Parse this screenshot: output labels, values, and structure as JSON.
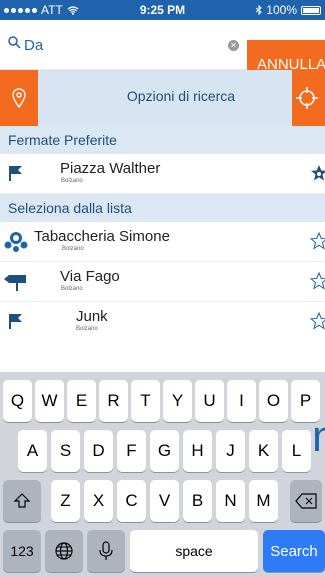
{
  "status_bar": {
    "carrier": "ATT",
    "time": "9:25 PM",
    "battery": "100%"
  },
  "search": {
    "query": "Da",
    "cancel_label": "ANNULLA"
  },
  "options": {
    "label": "Opzioni di ricerca"
  },
  "favorites": {
    "header": "Fermate Preferite",
    "items": [
      {
        "title": "Piazza Walther",
        "city": "Bolzano",
        "icon": "flag-icon"
      }
    ]
  },
  "list": {
    "header": "Seleziona dalla lista",
    "items": [
      {
        "title": "Tabaccheria Simone",
        "city": "Bolzano",
        "icon": "people-icon"
      },
      {
        "title": "Via Fago",
        "city": "Bolzano",
        "icon": "signpost-icon"
      },
      {
        "title": "Junk",
        "city": "Bolzano",
        "icon": "flag-icon"
      }
    ]
  },
  "keyboard": {
    "row1": [
      "Q",
      "W",
      "E",
      "R",
      "T",
      "Y",
      "U",
      "I",
      "O",
      "P"
    ],
    "row2": [
      "A",
      "S",
      "D",
      "F",
      "G",
      "H",
      "J",
      "K",
      "L"
    ],
    "row3": [
      "Z",
      "X",
      "C",
      "V",
      "B",
      "N",
      "M"
    ],
    "numbers_label": "123",
    "space_label": "space",
    "search_label": "Search"
  },
  "background_text": "n",
  "colors": {
    "primary": "#1f63ad",
    "accent": "#f26b1f",
    "section": "#dbe7f2"
  }
}
